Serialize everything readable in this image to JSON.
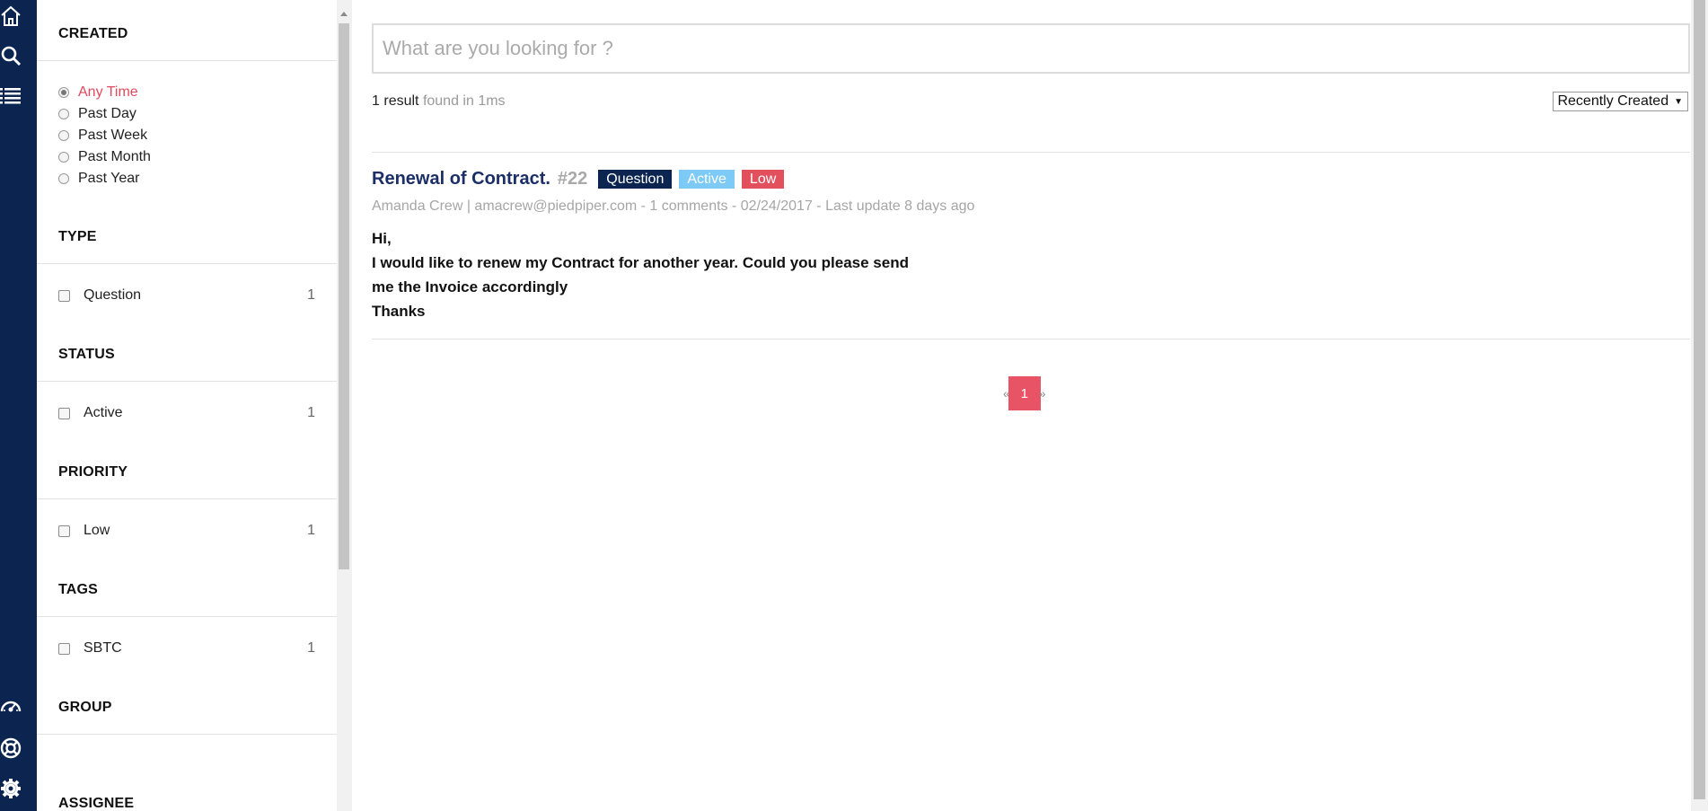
{
  "rail": {
    "icons": [
      "home-icon",
      "search-icon",
      "list-icon",
      "dashboard-icon",
      "help-icon",
      "settings-icon"
    ]
  },
  "filters": {
    "created": {
      "title": "CREATED",
      "options": [
        "Any Time",
        "Past Day",
        "Past Week",
        "Past Month",
        "Past Year"
      ],
      "selected": "Any Time"
    },
    "type": {
      "title": "TYPE",
      "items": [
        {
          "label": "Question",
          "count": "1"
        }
      ]
    },
    "status": {
      "title": "STATUS",
      "items": [
        {
          "label": "Active",
          "count": "1"
        }
      ]
    },
    "priority": {
      "title": "PRIORITY",
      "items": [
        {
          "label": "Low",
          "count": "1"
        }
      ]
    },
    "tags": {
      "title": "TAGS",
      "items": [
        {
          "label": "SBTC",
          "count": "1"
        }
      ]
    },
    "group": {
      "title": "GROUP"
    },
    "assignee": {
      "title": "ASSIGNEE"
    }
  },
  "search": {
    "placeholder": "What are you looking for ?"
  },
  "results": {
    "count": "1",
    "result_word": "result",
    "found_text": "found in 1ms",
    "sort_label": "Recently Created"
  },
  "ticket": {
    "title": "Renewal of Contract.",
    "number": "#22",
    "badges": {
      "type": "Question",
      "status": "Active",
      "priority": "Low"
    },
    "meta": "Amanda Crew | amacrew@piedpiper.com - 1 comments - 02/24/2017 - Last update 8 days ago",
    "body": [
      "Hi,",
      "I would like to renew my Contract for another year. Could you please send",
      "me the Invoice accordingly",
      "Thanks"
    ]
  },
  "pagination": {
    "prev": "«",
    "current": "1",
    "next": "»"
  },
  "colors": {
    "rail": "#0c2550",
    "accent": "#e85466",
    "badge_question": "#0c2550",
    "badge_active": "#7ccaf5",
    "badge_low": "#e2505e",
    "title": "#1b2f66"
  }
}
